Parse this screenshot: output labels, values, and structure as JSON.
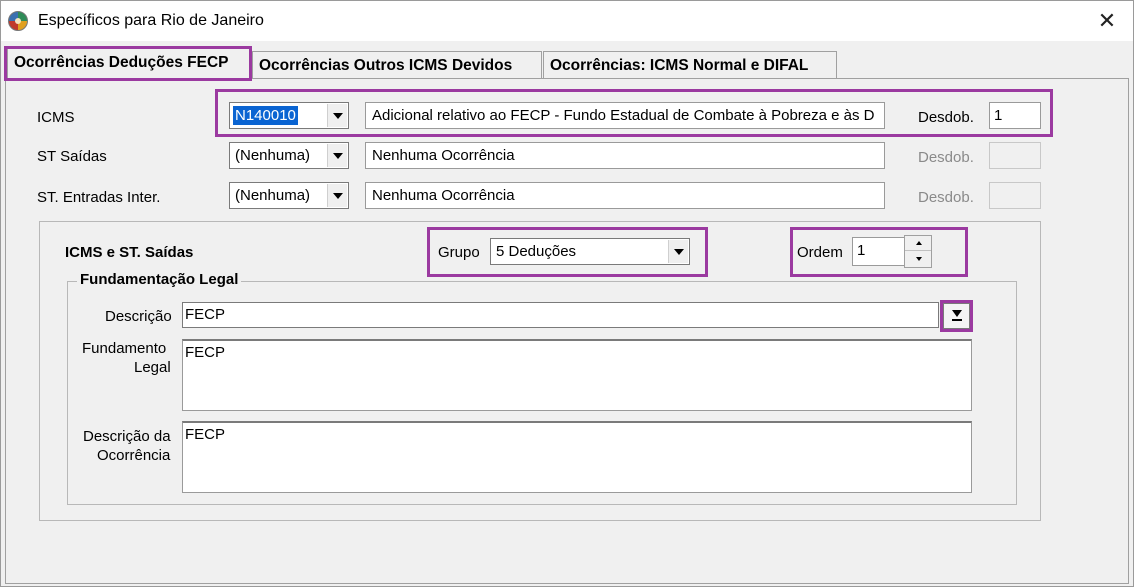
{
  "window": {
    "title": "Específicos para Rio de Janeiro",
    "close_glyph": "✕"
  },
  "tabs": [
    {
      "label": "Ocorrências Deduções FECP",
      "active": true
    },
    {
      "label": "Ocorrências Outros ICMS Devidos",
      "active": false
    },
    {
      "label": "Ocorrências: ICMS Normal e DIFAL",
      "active": false
    }
  ],
  "rows": {
    "icms": {
      "label": "ICMS",
      "code": "N140010",
      "description": "Adicional relativo ao FECP - Fundo Estadual de Combate à Pobreza e às D",
      "desdob_label": "Desdob.",
      "desdob_value": "1"
    },
    "st_saidas": {
      "label": "ST Saídas",
      "code": "(Nenhuma)",
      "description": "Nenhuma Ocorrência",
      "desdob_label": "Desdob.",
      "desdob_value": ""
    },
    "st_entradas": {
      "label": "ST. Entradas Inter.",
      "code": "(Nenhuma)",
      "description": "Nenhuma Ocorrência",
      "desdob_label": "Desdob.",
      "desdob_value": ""
    }
  },
  "group": {
    "title": "ICMS e ST. Saídas",
    "grupo_label": "Grupo",
    "grupo_value": "5  Deduções",
    "ordem_label": "Ordem",
    "ordem_value": "1"
  },
  "fundamentacao": {
    "legend": "Fundamentação Legal",
    "descricao_label": "Descrição",
    "descricao_value": "FECP",
    "fundamento_label_1": "Fundamento",
    "fundamento_label_2": "Legal",
    "fundamento_value": "FECP",
    "desc_ocorrencia_label_1": "Descrição da",
    "desc_ocorrencia_label_2": "Ocorrência",
    "desc_ocorrencia_value": "FECP"
  },
  "colors": {
    "highlight": "#9b3aa0",
    "selection": "#0a64d2",
    "window_bg": "#f0f0f0"
  },
  "icons": {
    "app": "app-globe-icon",
    "close": "close-icon",
    "download": "download-arrow-icon"
  }
}
